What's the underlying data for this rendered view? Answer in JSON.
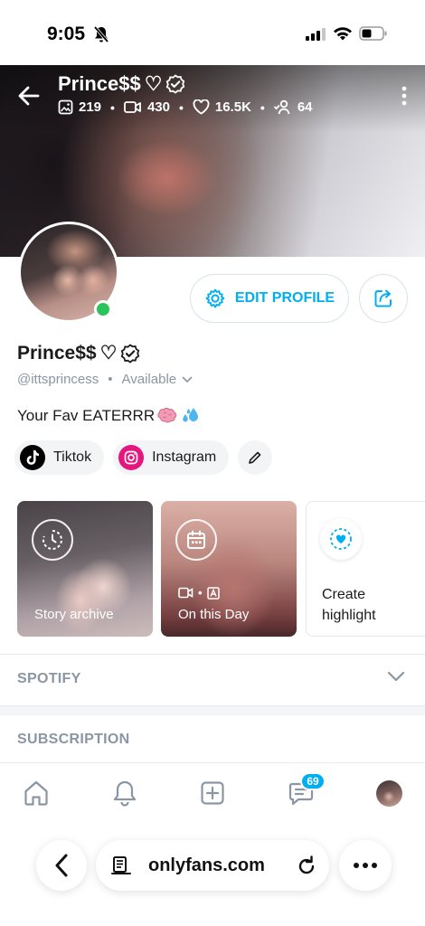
{
  "status_bar": {
    "time": "9:05"
  },
  "cover": {
    "name": "Prince$$",
    "heart": "♡",
    "stats": {
      "photos": "219",
      "videos": "430",
      "likes": "16.5K",
      "fans": "64"
    }
  },
  "profile": {
    "name": "Prince$$",
    "heart": "♡",
    "handle": "@ittsprincess",
    "availability": "Available",
    "bio": "Your Fav EATERRR",
    "bio_emojis": [
      "brain",
      "sweat-droplets"
    ],
    "edit_button": "EDIT PROFILE",
    "online": true
  },
  "social_links": [
    {
      "name": "Tiktok",
      "icon": "tiktok-icon"
    },
    {
      "name": "Instagram",
      "icon": "instagram-icon"
    }
  ],
  "highlights": {
    "archive_label": "Story archive",
    "onday_label": "On this Day",
    "create_label": "Create highlight"
  },
  "sections": {
    "spotify": "SPOTIFY",
    "subscription": "SUBSCRIPTION"
  },
  "nav": {
    "messages_badge": "69"
  },
  "browser": {
    "url": "onlyfans.com"
  },
  "colors": {
    "accent": "#00aff0",
    "online": "#2bc45a",
    "instagram": "#e4177f"
  }
}
